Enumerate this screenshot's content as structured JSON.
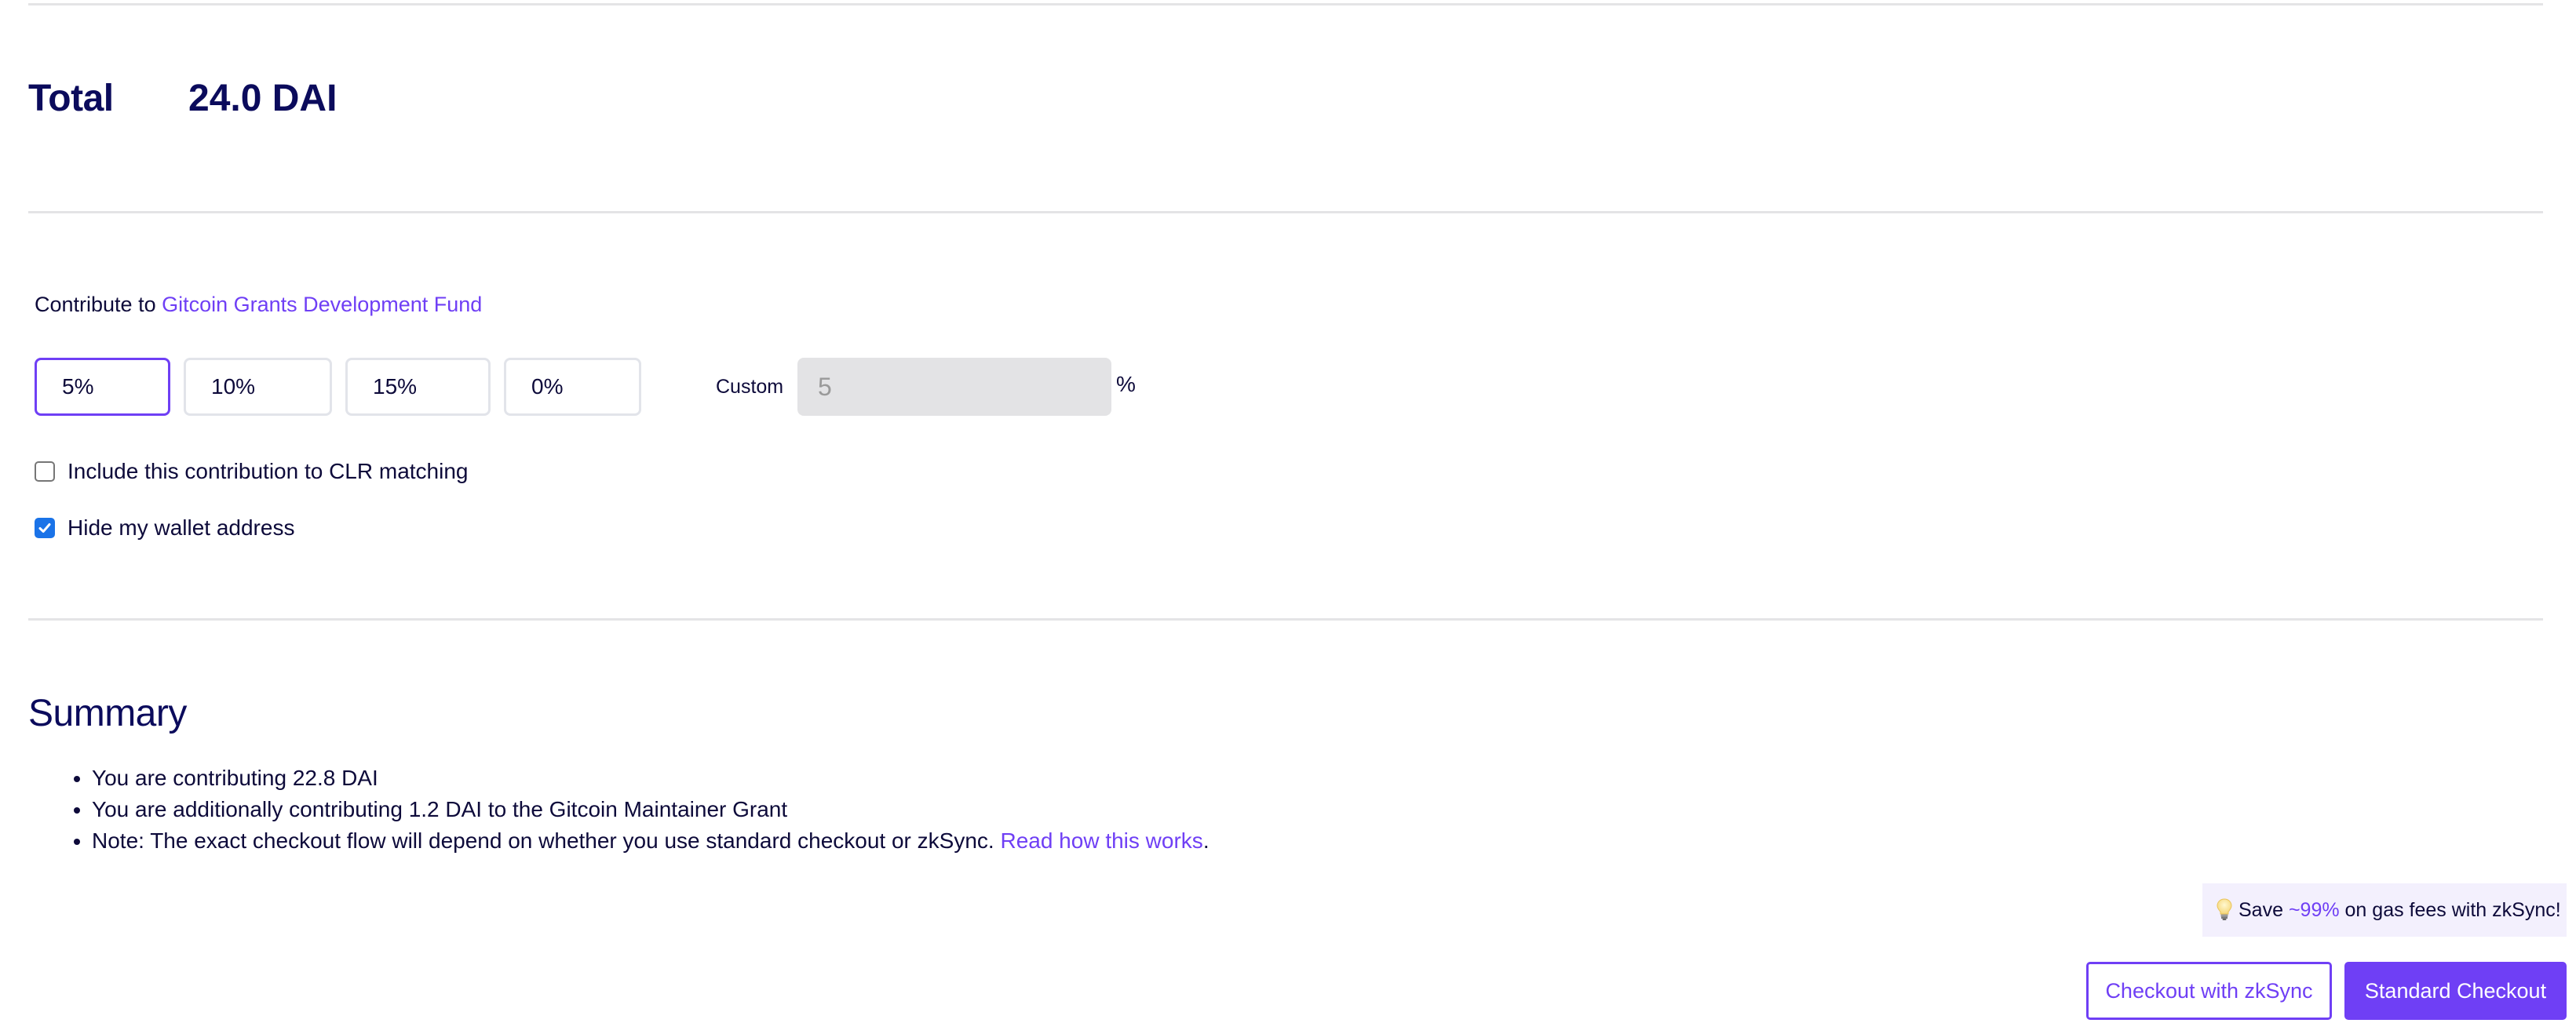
{
  "total": {
    "label": "Total",
    "value": "24.0 DAI"
  },
  "contribute": {
    "prefix": "Contribute to",
    "fund_link": "Gitcoin Grants Development Fund",
    "percent_options": [
      {
        "label": "5%",
        "selected": true
      },
      {
        "label": "10%",
        "selected": false
      },
      {
        "label": "15%",
        "selected": false
      },
      {
        "label": "0%",
        "selected": false
      }
    ],
    "custom_label": "Custom",
    "custom_value": "5",
    "custom_suffix": "%"
  },
  "options": {
    "clr_matching": {
      "label": "Include this contribution to CLR matching",
      "checked": false
    },
    "hide_wallet": {
      "label": "Hide my wallet address",
      "checked": true
    }
  },
  "summary": {
    "title": "Summary",
    "items": [
      "You are contributing 22.8 DAI",
      "You are additionally contributing 1.2 DAI to the Gitcoin Maintainer Grant"
    ],
    "note_text": "Note: The exact checkout flow will depend on whether you use standard checkout or zkSync.",
    "note_link": "Read how this works",
    "note_end": "."
  },
  "banner": {
    "icon": "lightbulb-icon",
    "prefix": "Save",
    "highlight": "~99%",
    "suffix": "on gas fees with zkSync!"
  },
  "actions": {
    "zksync_label": "Checkout with zkSync",
    "standard_label": "Standard Checkout"
  },
  "colors": {
    "accent": "#6f3ff5",
    "heading": "#0b0b5c",
    "text": "#0d0a3a",
    "divider": "#e4e4e6",
    "banner_bg": "#f3f0fd",
    "checkbox_checked": "#1a73e8"
  }
}
